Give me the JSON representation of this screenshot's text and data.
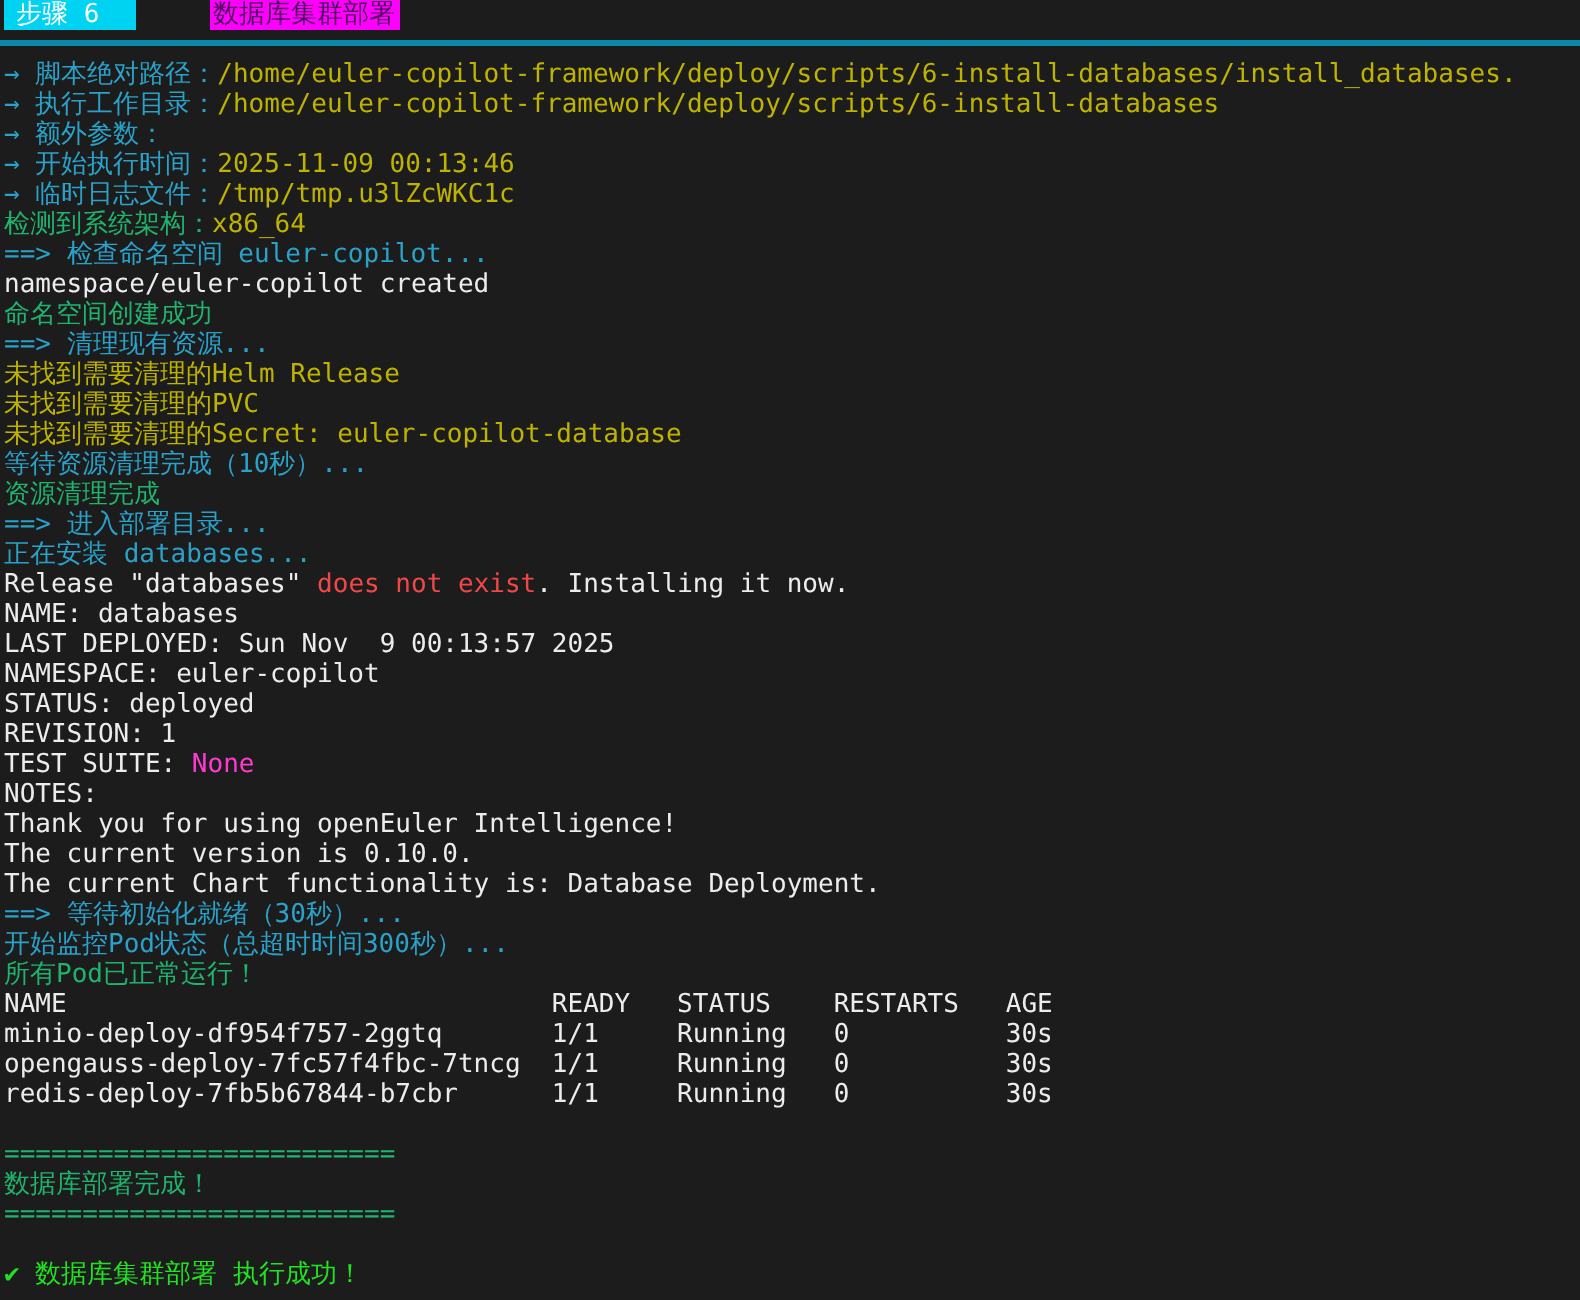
{
  "header": {
    "step": "步骤 6",
    "title": "数据库集群部署"
  },
  "lines": [
    {
      "kind": "text",
      "segments": [
        {
          "text": "→ 脚本绝对路径：",
          "color": "#2aa1c8"
        },
        {
          "text": "/home/euler-copilot-framework/deploy/scripts/6-install-databases/install_databases.",
          "color": "#bdb300"
        }
      ]
    },
    {
      "kind": "text",
      "segments": [
        {
          "text": "→ 执行工作目录：",
          "color": "#2aa1c8"
        },
        {
          "text": "/home/euler-copilot-framework/deploy/scripts/6-install-databases",
          "color": "#bdb300"
        }
      ]
    },
    {
      "kind": "text",
      "segments": [
        {
          "text": "→ 额外参数：",
          "color": "#2aa1c8"
        }
      ]
    },
    {
      "kind": "text",
      "segments": [
        {
          "text": "→ 开始执行时间：",
          "color": "#2aa1c8"
        },
        {
          "text": "2025-11-09 00:13:46",
          "color": "#bdb300"
        }
      ]
    },
    {
      "kind": "text",
      "segments": [
        {
          "text": "→ 临时日志文件：",
          "color": "#2aa1c8"
        },
        {
          "text": "/tmp/tmp.u3lZcWKC1c",
          "color": "#bdb300"
        }
      ]
    },
    {
      "kind": "text",
      "segments": [
        {
          "text": "检测到系统架构：",
          "color": "#1fb36e"
        },
        {
          "text": "x86_64",
          "color": "#bdb300"
        }
      ]
    },
    {
      "kind": "text",
      "segments": [
        {
          "text": "==> 检查命名空间 euler-copilot...",
          "color": "#2aa1c8"
        }
      ]
    },
    {
      "kind": "text",
      "segments": [
        {
          "text": "namespace/euler-copilot created",
          "color": "#ececec"
        }
      ]
    },
    {
      "kind": "text",
      "segments": [
        {
          "text": "命名空间创建成功",
          "color": "#1fb36e"
        }
      ]
    },
    {
      "kind": "text",
      "segments": [
        {
          "text": "==> 清理现有资源...",
          "color": "#2aa1c8"
        }
      ]
    },
    {
      "kind": "text",
      "segments": [
        {
          "text": "未找到需要清理的Helm Release",
          "color": "#bdb300"
        }
      ]
    },
    {
      "kind": "text",
      "segments": [
        {
          "text": "未找到需要清理的PVC",
          "color": "#bdb300"
        }
      ]
    },
    {
      "kind": "text",
      "segments": [
        {
          "text": "未找到需要清理的Secret: euler-copilot-database",
          "color": "#bdb300"
        }
      ]
    },
    {
      "kind": "text",
      "segments": [
        {
          "text": "等待资源清理完成（10秒）...",
          "color": "#2aa1c8"
        }
      ]
    },
    {
      "kind": "text",
      "segments": [
        {
          "text": "资源清理完成",
          "color": "#1fb36e"
        }
      ]
    },
    {
      "kind": "text",
      "segments": [
        {
          "text": "==> 进入部署目录...",
          "color": "#2aa1c8"
        }
      ]
    },
    {
      "kind": "text",
      "segments": [
        {
          "text": "正在安装 databases...",
          "color": "#2aa1c8"
        }
      ]
    },
    {
      "kind": "text",
      "segments": [
        {
          "text": "Release \"databases\" ",
          "color": "#ececec"
        },
        {
          "text": "does not exist",
          "color": "#f04848"
        },
        {
          "text": ". Installing it now.",
          "color": "#ececec"
        }
      ]
    },
    {
      "kind": "text",
      "segments": [
        {
          "text": "NAME: databases",
          "color": "#ececec"
        }
      ]
    },
    {
      "kind": "text",
      "segments": [
        {
          "text": "LAST DEPLOYED: Sun Nov  9 00:13:57 2025",
          "color": "#ececec"
        }
      ]
    },
    {
      "kind": "text",
      "segments": [
        {
          "text": "NAMESPACE: euler-copilot",
          "color": "#ececec"
        }
      ]
    },
    {
      "kind": "text",
      "segments": [
        {
          "text": "STATUS: deployed",
          "color": "#ececec"
        }
      ]
    },
    {
      "kind": "text",
      "segments": [
        {
          "text": "REVISION: 1",
          "color": "#ececec"
        }
      ]
    },
    {
      "kind": "text",
      "segments": [
        {
          "text": "TEST SUITE: ",
          "color": "#ececec"
        },
        {
          "text": "None",
          "color": "#ff3ad2"
        }
      ]
    },
    {
      "kind": "text",
      "segments": [
        {
          "text": "NOTES:",
          "color": "#ececec"
        }
      ]
    },
    {
      "kind": "text",
      "segments": [
        {
          "text": "Thank you for using openEuler Intelligence!",
          "color": "#ececec"
        }
      ]
    },
    {
      "kind": "text",
      "segments": [
        {
          "text": "The current version is 0.10.0.",
          "color": "#ececec"
        }
      ]
    },
    {
      "kind": "text",
      "segments": [
        {
          "text": "The current Chart functionality is: Database Deployment.",
          "color": "#ececec"
        }
      ]
    },
    {
      "kind": "text",
      "segments": [
        {
          "text": "==> 等待初始化就绪（30秒）...",
          "color": "#2aa1c8"
        }
      ]
    },
    {
      "kind": "text",
      "segments": [
        {
          "text": "开始监控Pod状态（总超时时间300秒）...",
          "color": "#2aa1c8"
        }
      ]
    },
    {
      "kind": "text",
      "segments": [
        {
          "text": "所有Pod已正常运行！",
          "color": "#1fb36e"
        }
      ]
    },
    {
      "kind": "text",
      "segments": [
        {
          "text": "NAME                               READY   STATUS    RESTARTS   AGE",
          "color": "#ececec"
        }
      ]
    },
    {
      "kind": "text",
      "segments": [
        {
          "text": "minio-deploy-df954f757-2ggtq       1/1     Running   0          30s",
          "color": "#ececec"
        }
      ]
    },
    {
      "kind": "text",
      "segments": [
        {
          "text": "opengauss-deploy-7fc57f4fbc-7tncg  1/1     Running   0          30s",
          "color": "#ececec"
        }
      ]
    },
    {
      "kind": "text",
      "segments": [
        {
          "text": "redis-deploy-7fb5b67844-b7cbr      1/1     Running   0          30s",
          "color": "#ececec"
        }
      ]
    },
    {
      "kind": "blank"
    },
    {
      "kind": "text",
      "segments": [
        {
          "text": "=========================",
          "color": "#1fb36e"
        }
      ]
    },
    {
      "kind": "text",
      "segments": [
        {
          "text": "数据库部署完成！",
          "color": "#1fb36e"
        }
      ]
    },
    {
      "kind": "text",
      "segments": [
        {
          "text": "=========================",
          "color": "#1fb36e"
        }
      ]
    },
    {
      "kind": "blank"
    },
    {
      "kind": "text",
      "segments": [
        {
          "text": "✔ 数据库集群部署 执行成功！",
          "color": "#22e022"
        }
      ]
    }
  ]
}
